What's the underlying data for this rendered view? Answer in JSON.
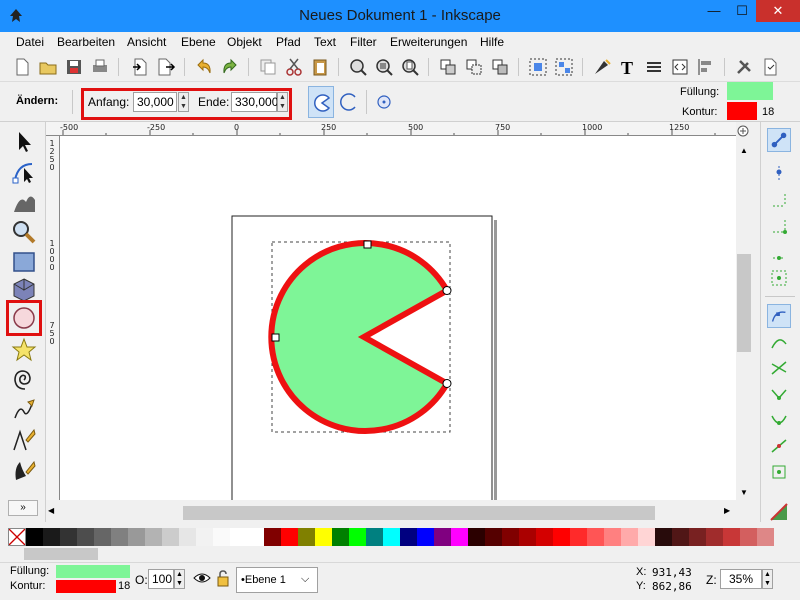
{
  "window": {
    "title": "Neues Dokument 1 - Inkscape",
    "minimize": "—",
    "maximize": "☐",
    "close": "✕"
  },
  "menu": [
    "Datei",
    "Bearbeiten",
    "Ansicht",
    "Ebene",
    "Objekt",
    "Pfad",
    "Text",
    "Filter",
    "Erweiterungen",
    "Hilfe"
  ],
  "tool_controls": {
    "label": "Ändern:",
    "start_label": "Anfang:",
    "start_value": "30,000",
    "end_label": "Ende:",
    "end_value": "330,000",
    "fill_label": "Füllung:",
    "stroke_label": "Kontur:",
    "stroke_width": "18"
  },
  "ruler": {
    "h_ticks": [
      "-500",
      "-250",
      "0",
      "250",
      "500",
      "750",
      "1000",
      "1250"
    ],
    "v_ticks": [
      "1250",
      "1000",
      "750"
    ]
  },
  "status": {
    "fill_label": "Füllung:",
    "stroke_label": "Kontur:",
    "stroke_width": "18",
    "opacity_label": "O:",
    "opacity_value": "100",
    "layer": "•Ebene 1",
    "x_label": "X:",
    "x_value": "931,43",
    "y_label": "Y:",
    "y_value": "862,86",
    "zoom_label": "Z:",
    "zoom_value": "35%"
  },
  "colors": {
    "fill": "#7ef597",
    "stroke": "#ff0000",
    "highlight": "#e01010",
    "titlebar": "#1e90ff"
  },
  "shape": {
    "type": "arc",
    "start_angle": 30,
    "end_angle": 330
  },
  "icons": {
    "selector": "selector-tool-icon",
    "node": "node-tool-icon",
    "tweak": "tweak-tool-icon",
    "zoom": "zoom-tool-icon",
    "rect": "rectangle-tool-icon",
    "box3d": "3d-box-tool-icon",
    "ellipse": "ellipse-tool-icon",
    "star": "star-tool-icon",
    "spiral": "spiral-tool-icon",
    "pencil": "pencil-tool-icon",
    "pen": "pen-tool-icon",
    "calligraphy": "calligraphy-tool-icon"
  }
}
